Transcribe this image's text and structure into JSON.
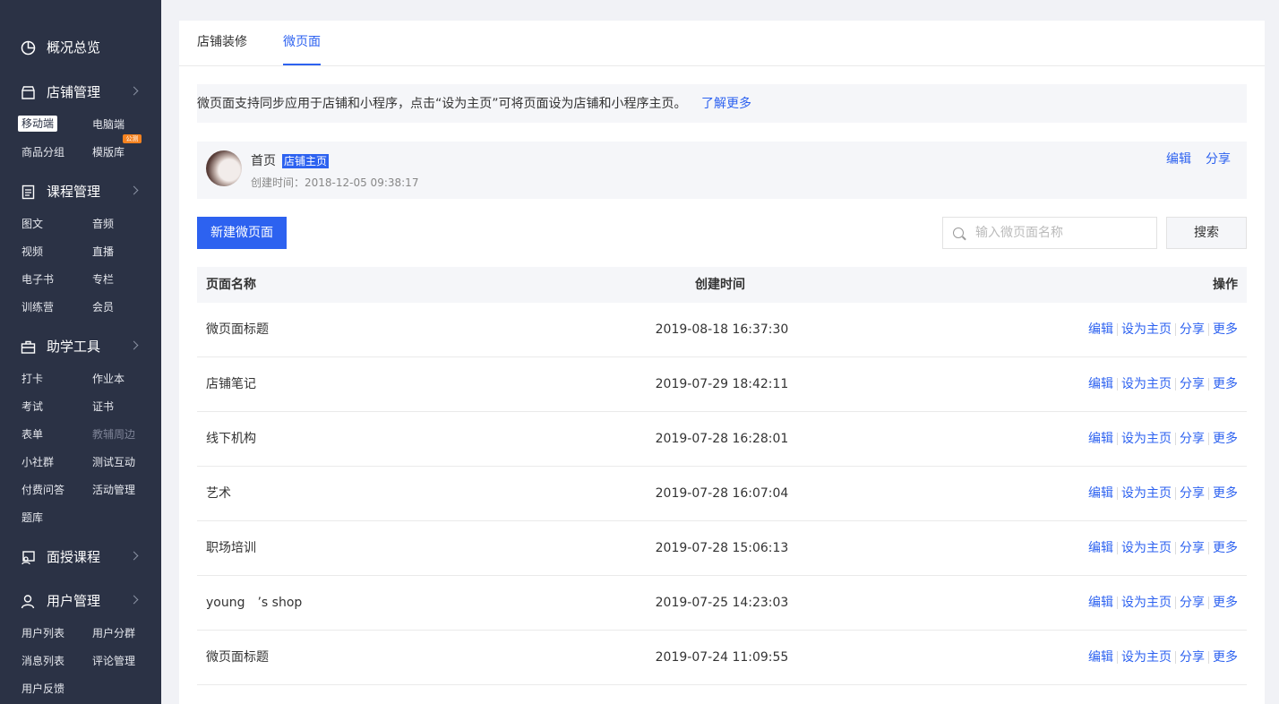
{
  "sidebar": {
    "overview": "概况总览",
    "store_mgmt": "店铺管理",
    "store_items": [
      "移动端",
      "电脑端",
      "商品分组",
      "模版库"
    ],
    "new_badge": "公测",
    "course_mgmt": "课程管理",
    "course_items": [
      "图文",
      "音频",
      "视频",
      "直播",
      "电子书",
      "专栏",
      "训练营",
      "会员"
    ],
    "tools": "助学工具",
    "tool_items": [
      "打卡",
      "作业本",
      "考试",
      "证书",
      "表单",
      "教辅周边",
      "小社群",
      "测试互动",
      "付费问答",
      "活动管理",
      "题库"
    ],
    "offline": "面授课程",
    "user_mgmt": "用户管理",
    "user_items": [
      "用户列表",
      "用户分群",
      "消息列表",
      "评论管理",
      "用户反馈"
    ]
  },
  "tabs": [
    "店铺装修",
    "微页面"
  ],
  "notice": {
    "text": "微页面支持同步应用于店铺和小程序，点击“设为主页”可将页面设为店铺和小程序主页。",
    "link": "了解更多"
  },
  "home": {
    "title": "首页",
    "badge": "店铺主页",
    "created": "创建时间：2018-12-05 09:38:17",
    "edit": "编辑",
    "share": "分享"
  },
  "toolbar": {
    "new_button": "新建微页面",
    "search_placeholder": "输入微页面名称",
    "search_button": "搜索"
  },
  "table": {
    "headers": [
      "页面名称",
      "创建时间",
      "操作"
    ],
    "rows": [
      {
        "name": "微页面标题",
        "time": "2019-08-18 16:37:30"
      },
      {
        "name": "店铺笔记",
        "time": "2019-07-29 18:42:11"
      },
      {
        "name": "线下机构",
        "time": "2019-07-28 16:28:01"
      },
      {
        "name": "艺术",
        "time": "2019-07-28 16:07:04"
      },
      {
        "name": "职场培训",
        "time": "2019-07-28 15:06:13"
      },
      {
        "name": "young　’s shop",
        "time": "2019-07-25 14:23:03"
      },
      {
        "name": "微页面标题",
        "time": "2019-07-24 11:09:55"
      }
    ],
    "actions": [
      "编辑",
      "设为主页",
      "分享",
      "更多"
    ]
  },
  "colors": {
    "sidebar_bg": "#2b3245",
    "accent": "#2d62f0",
    "badge": "#f5821f"
  }
}
